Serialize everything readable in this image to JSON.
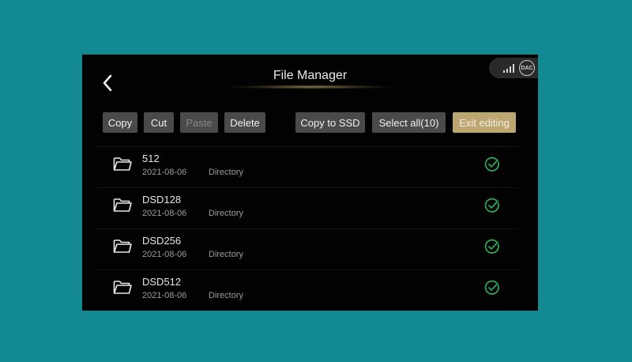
{
  "header": {
    "title": "File Manager",
    "dac_label": "DAC"
  },
  "toolbar": {
    "copy": "Copy",
    "cut": "Cut",
    "paste": "Paste",
    "delete": "Delete",
    "copy_to_ssd": "Copy to SSD",
    "select_all": "Select all(10)",
    "exit_editing": "Exit editing"
  },
  "files": [
    {
      "name": "512",
      "date": "2021-08-06",
      "type": "Directory",
      "selected": true
    },
    {
      "name": "DSD128",
      "date": "2021-08-06",
      "type": "Directory",
      "selected": true
    },
    {
      "name": "DSD256",
      "date": "2021-08-06",
      "type": "Directory",
      "selected": true
    },
    {
      "name": "DSD512",
      "date": "2021-08-06",
      "type": "Directory",
      "selected": true
    }
  ],
  "colors": {
    "background": "#138a92",
    "screen": "#020202",
    "button": "#4a4a4a",
    "accent_gold": "#bca772",
    "check_green": "#2fa34e"
  },
  "icons": {
    "back": "chevron-left-icon",
    "signal": "signal-bars-icon",
    "folder": "folder-icon",
    "check": "check-circle-icon"
  }
}
